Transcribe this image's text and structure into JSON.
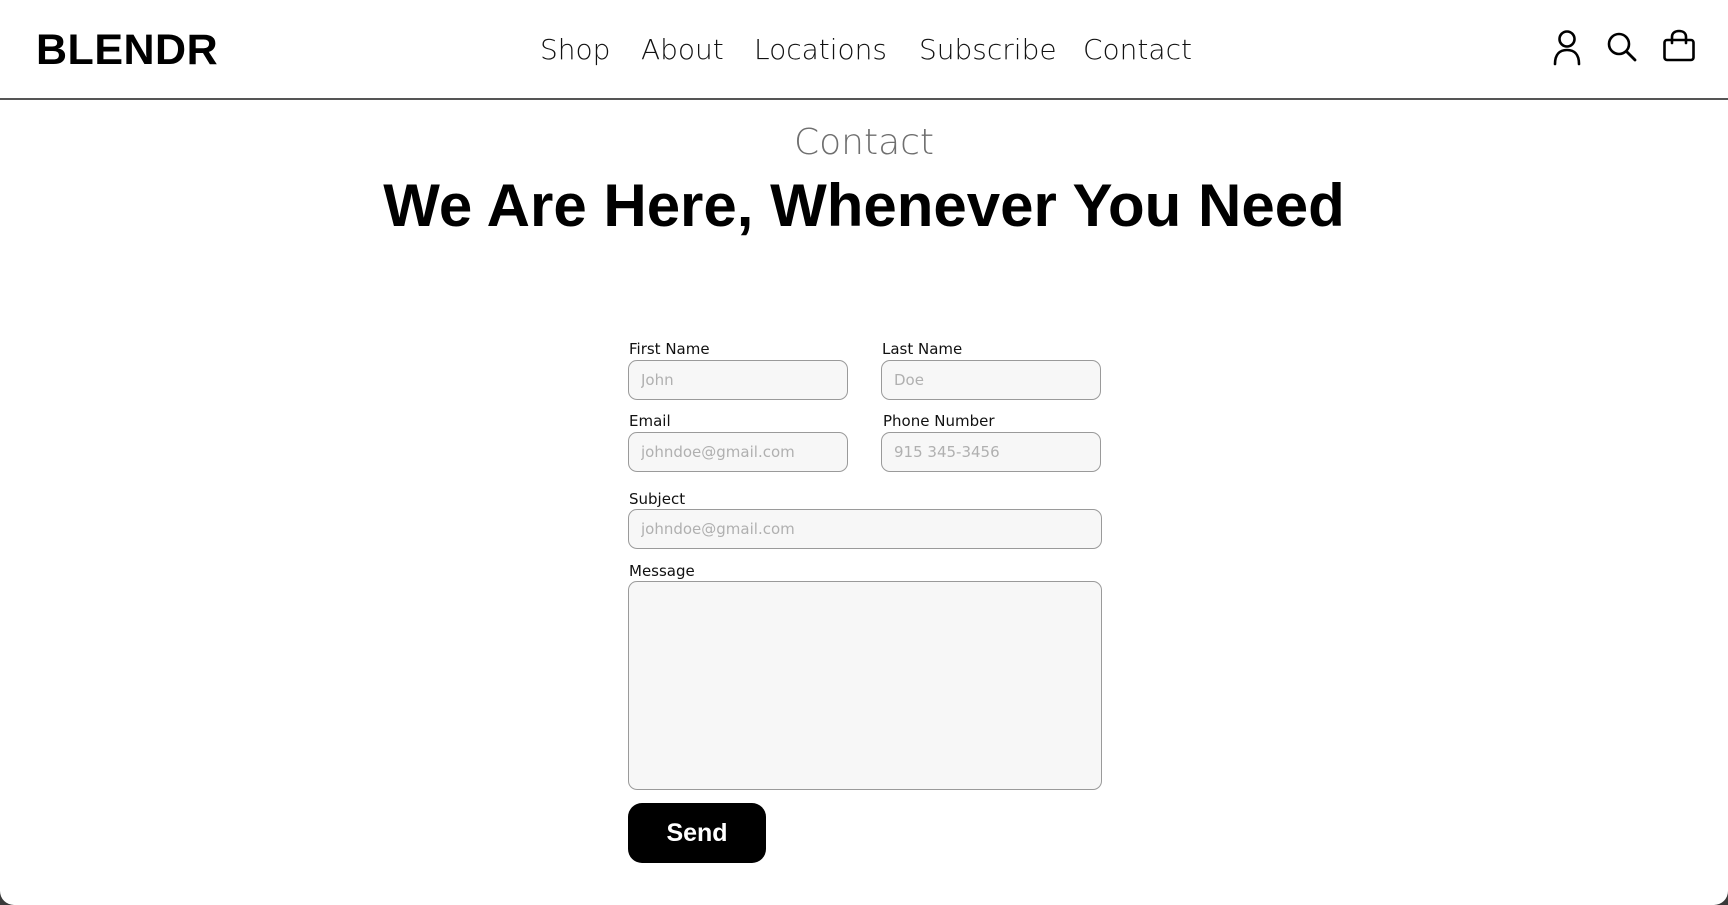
{
  "header": {
    "logo": "BLENDR",
    "nav": {
      "shop": "Shop",
      "about": "About",
      "locations": "Locations",
      "subscribe": "Subscribe",
      "contact": "Contact"
    },
    "icons": [
      "user-icon",
      "search-icon",
      "bag-icon"
    ]
  },
  "hero": {
    "eyebrow": "Contact",
    "headline": "We Are Here, Whenever You Need"
  },
  "form": {
    "first_name": {
      "label": "First Name",
      "placeholder": "John",
      "value": ""
    },
    "last_name": {
      "label": "Last Name",
      "placeholder": "Doe",
      "value": ""
    },
    "email": {
      "label": "Email",
      "placeholder": "johndoe@gmail.com",
      "value": ""
    },
    "phone": {
      "label": "Phone Number",
      "placeholder": "915 345-3456",
      "value": ""
    },
    "subject": {
      "label": "Subject",
      "placeholder": "johndoe@gmail.com",
      "value": ""
    },
    "message": {
      "label": "Message",
      "placeholder": "",
      "value": ""
    },
    "send_label": "Send"
  },
  "colors": {
    "background": "#ffffff",
    "text": "#000000",
    "muted": "#6f6f6f",
    "field_bg": "#f7f7f7",
    "field_border": "#9a9a9a",
    "button_bg": "#000000",
    "button_text": "#ffffff"
  }
}
